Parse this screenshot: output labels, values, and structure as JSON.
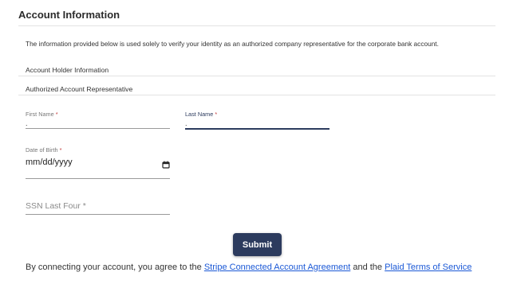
{
  "page": {
    "title": "Account Information",
    "intro": "The information provided below is used solely to verify your identity as an authorized company representative for the corporate bank account.",
    "section_account_holder": "Account Holder Information",
    "section_authorized_rep": "Authorized Account Representative"
  },
  "form": {
    "first_name": {
      "label": "First Name",
      "required_mark": "*",
      "value": "."
    },
    "last_name": {
      "label": "Last Name",
      "required_mark": "*",
      "value": "."
    },
    "dob": {
      "label": "Date of Birth",
      "required_mark": "*",
      "value": "mm/dd/yyyy",
      "icon": "calendar-icon"
    },
    "ssn": {
      "placeholder": "SSN Last Four *"
    },
    "submit_label": "Submit"
  },
  "footer": {
    "text_before": "By connecting your account, you agree to the",
    "link_stripe": "Stripe Connected Account Agreement",
    "text_middle": "and the",
    "link_plaid": "Plaid Terms of Service"
  },
  "colors": {
    "accent": "#2c3b5e",
    "link": "#1a58d6",
    "required": "#c23b3b"
  }
}
